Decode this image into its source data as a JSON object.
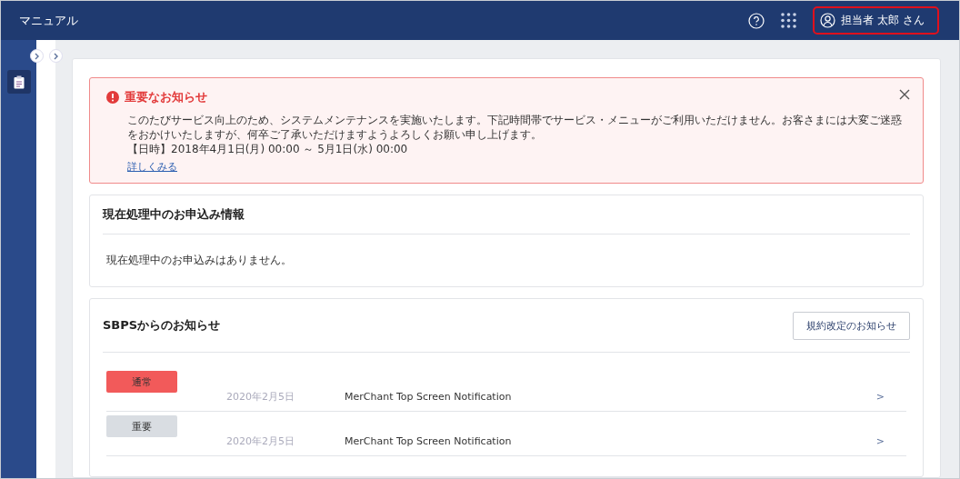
{
  "header": {
    "title": "マニュアル",
    "user": "担当者 太郎 さん"
  },
  "alert": {
    "title": "重要なお知らせ",
    "body": "このたびサービス向上のため、システムメンテナンスを実施いたします。下記時間帯でサービス・メニューがご利用いただけません。お客さまには大変ご迷惑をおかけいたしますが、何卒ご了承いただけますようよろしくお願い申し上げます。",
    "schedule": "【日時】2018年4月1日(月) 00:00 ～ 5月1日(水) 00:00",
    "link": "詳しくみる"
  },
  "processing": {
    "title": "現在処理中のお申込み情報",
    "message": "現在処理中のお申込みはありません。"
  },
  "notices": {
    "title": "SBPSからのお知らせ",
    "button": "規約改定のお知らせ",
    "rows": [
      {
        "tag": "通常",
        "color": "#f25a5a",
        "date": "2020年2月5日",
        "text": "MerChant Top Screen Notification",
        "arrow": ">"
      },
      {
        "tag": "重要",
        "color": "#d9dde2",
        "date": "2020年2月5日",
        "text": "MerChant Top Screen Notification",
        "arrow": ">"
      }
    ]
  }
}
